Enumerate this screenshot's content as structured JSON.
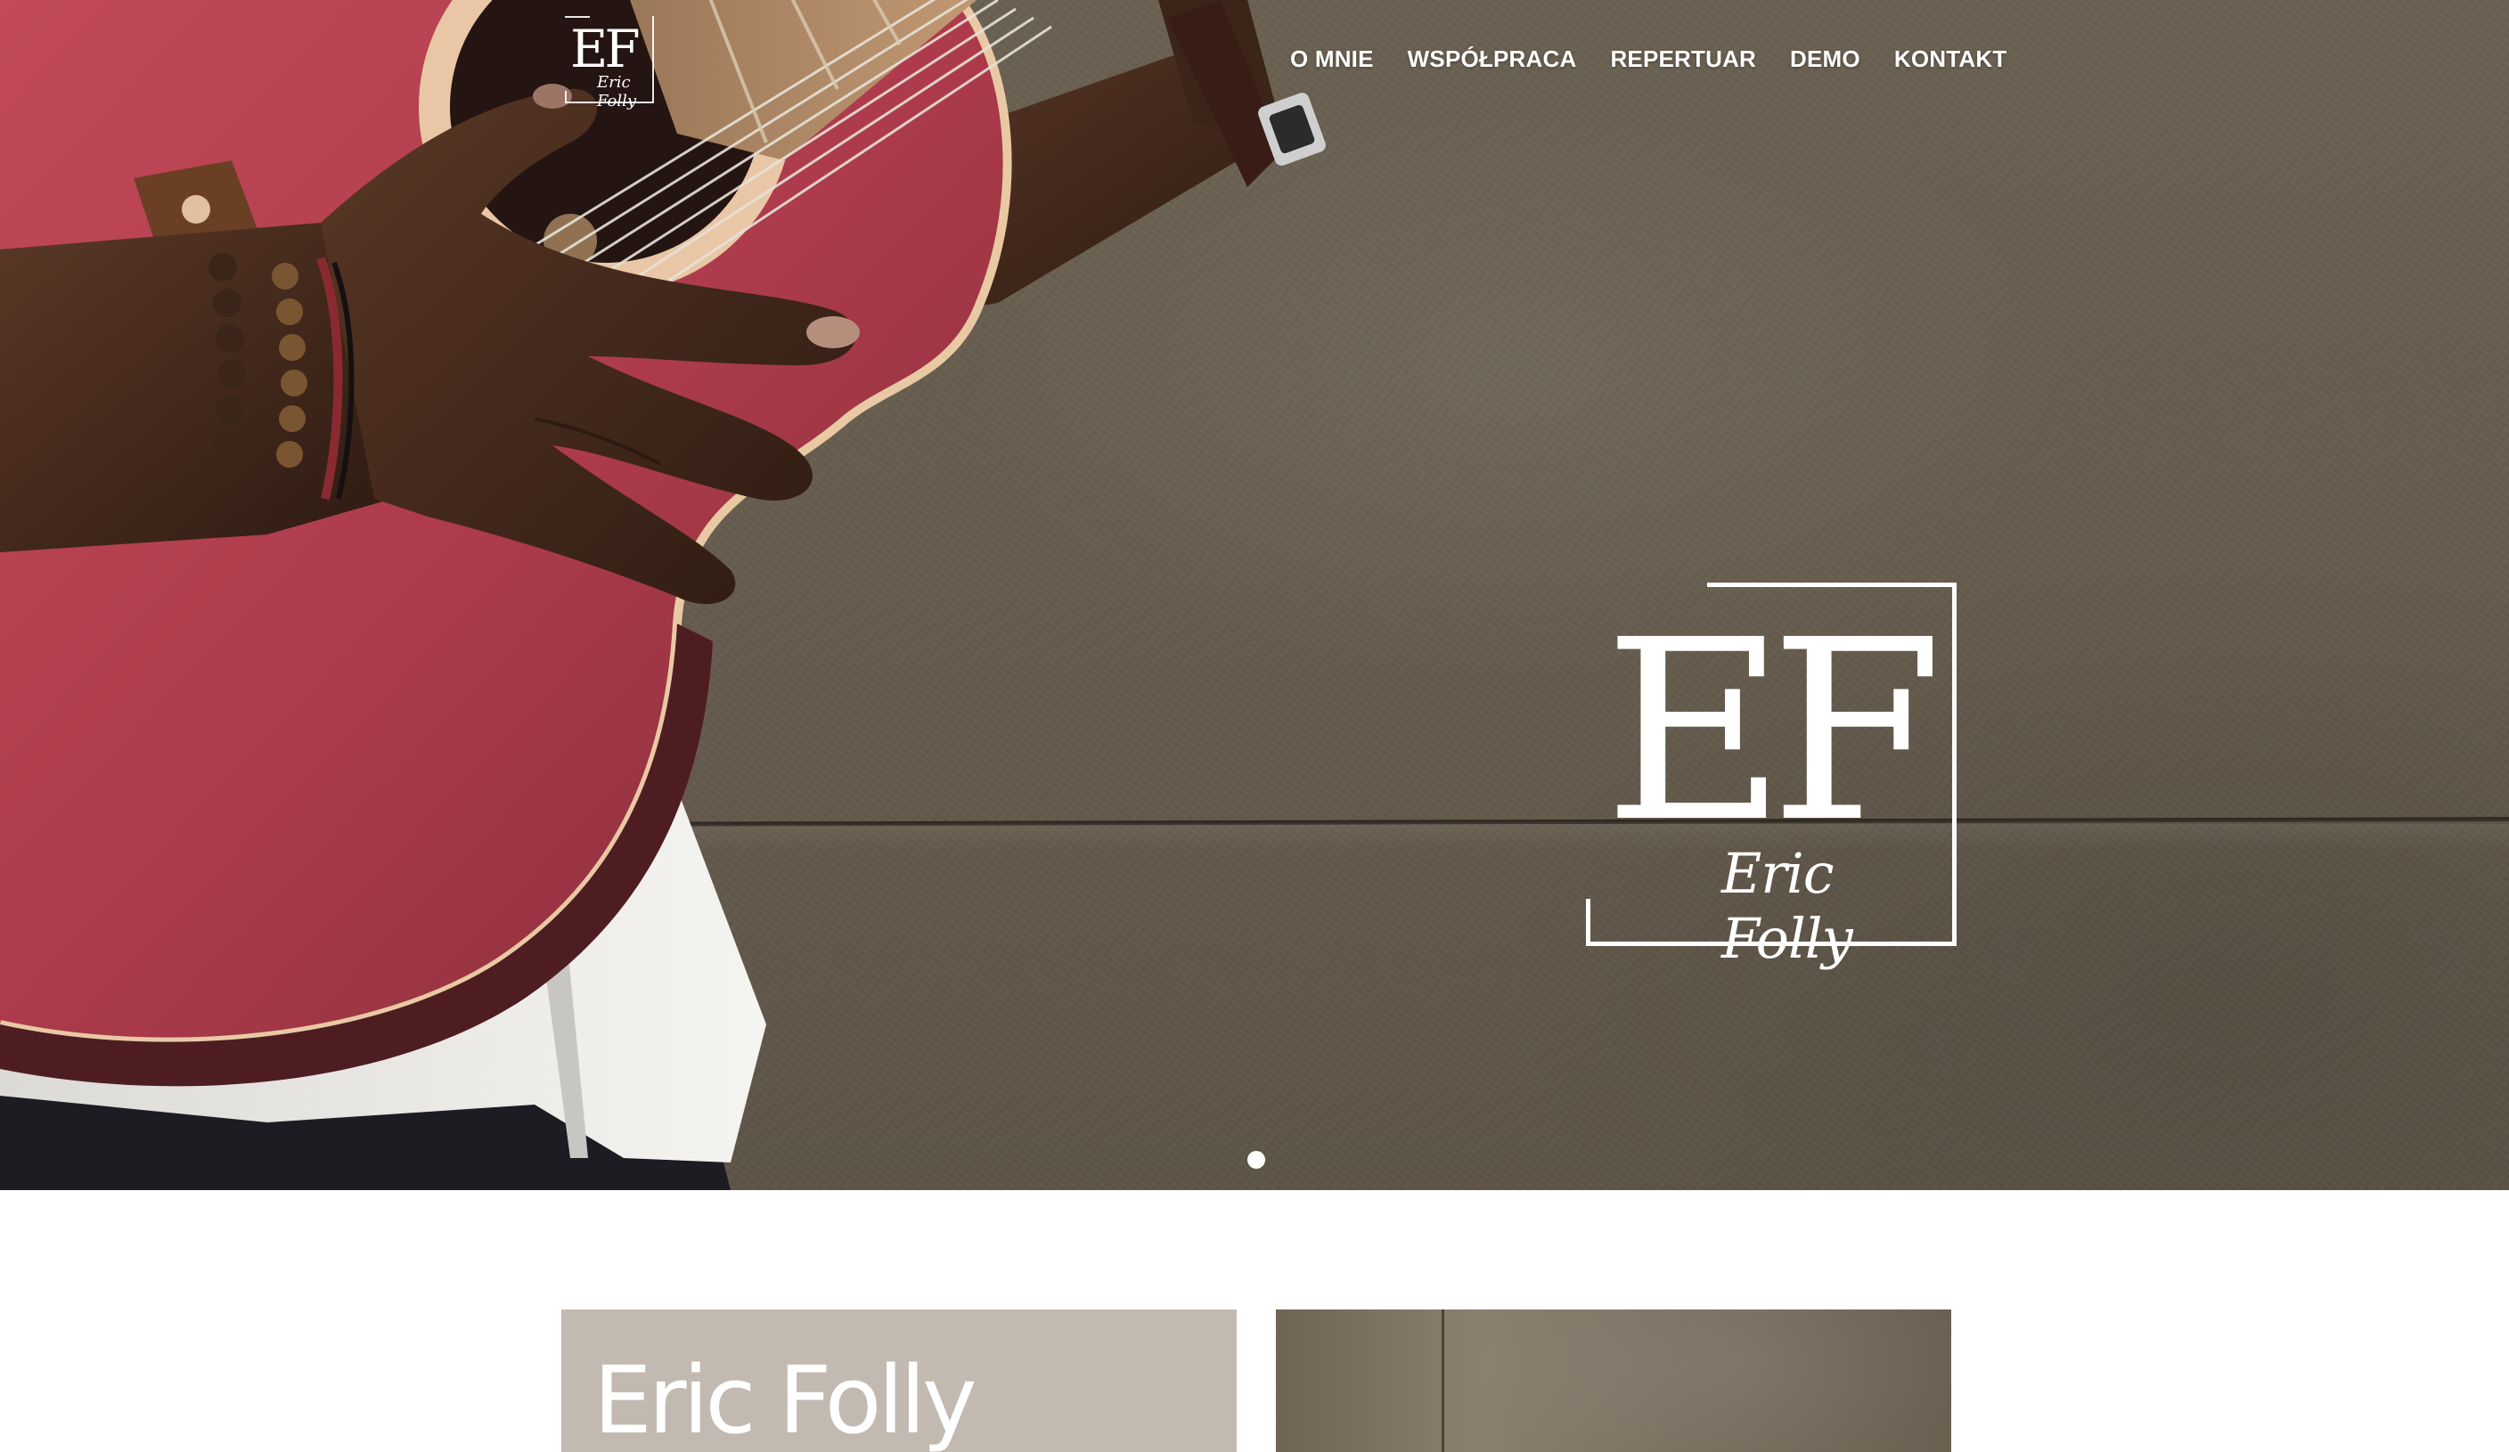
{
  "header": {
    "logo": {
      "monogram": "EF",
      "signature": "Eric Folly"
    },
    "nav": [
      {
        "label": "O MNIE"
      },
      {
        "label": "WSPÓŁPRACA"
      },
      {
        "label": "REPERTUAR"
      },
      {
        "label": "DEMO"
      },
      {
        "label": "KONTAKT"
      }
    ]
  },
  "hero": {
    "logo": {
      "monogram": "EF",
      "signature": "Eric Folly"
    },
    "slider": {
      "slide_count": 1,
      "active_slide": 1
    }
  },
  "intro": {
    "title": "Eric Folly"
  },
  "colors": {
    "wall": "#675d4f",
    "guitar": "#b6404f",
    "card_left": "#c2bab1",
    "text": "#ffffff"
  }
}
